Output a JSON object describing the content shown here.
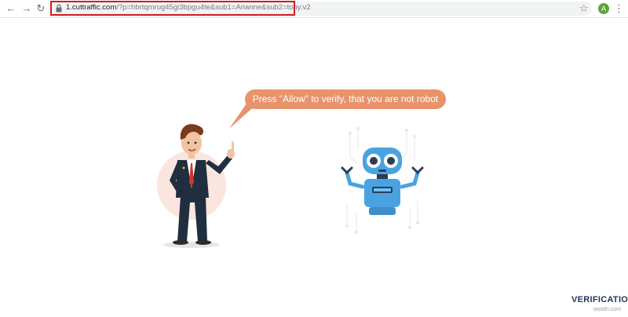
{
  "browser": {
    "url_host": "1.cuttraffic.com",
    "url_path": "/?p=hbrtqmrug45gi3bpgu4te&sub1=Arianne&sub2=tony.v2",
    "profile_initial": "A"
  },
  "page": {
    "bubble_text": "Press \"Allow\" to verify, that you are not robot"
  },
  "watermark": {
    "main": "VERIFICATION",
    "sub": "wsxdn.com"
  },
  "colors": {
    "highlight": "#d7191e",
    "bubble": "#e8936b",
    "robot": "#4aa3e0",
    "suit": "#1f2f3f"
  }
}
